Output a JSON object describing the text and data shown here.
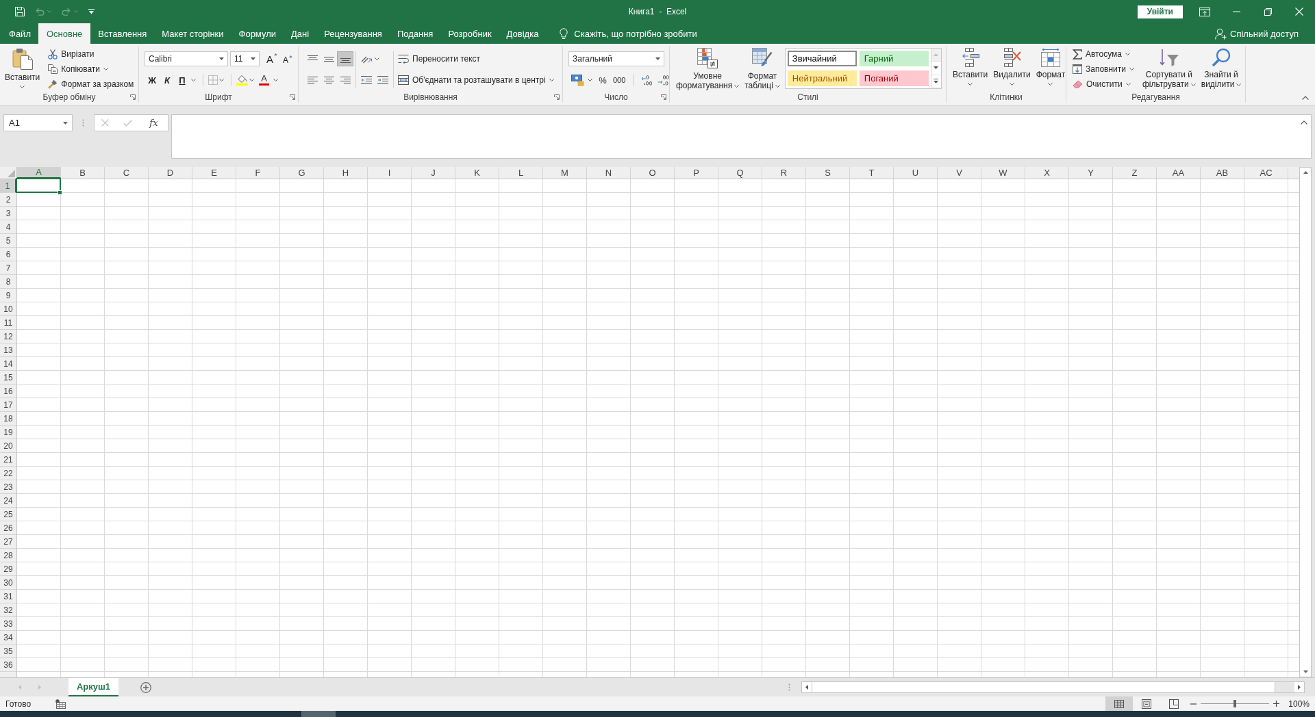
{
  "quick_access": [
    {
      "kind": "save",
      "disabled": false
    },
    {
      "kind": "undo",
      "disabled": true
    },
    {
      "kind": "redo",
      "disabled": true
    },
    {
      "kind": "customize",
      "disabled": false
    }
  ],
  "window": {
    "title": "Книга1  -  Excel",
    "sign_in": "Увійти"
  },
  "ribbon_tabs": [
    {
      "label": "Файл",
      "selected": false
    },
    {
      "label": "Основне",
      "selected": true
    },
    {
      "label": "Вставлення",
      "selected": false
    },
    {
      "label": "Макет сторінки",
      "selected": false
    },
    {
      "label": "Формули",
      "selected": false
    },
    {
      "label": "Дані",
      "selected": false
    },
    {
      "label": "Рецензування",
      "selected": false
    },
    {
      "label": "Подання",
      "selected": false
    },
    {
      "label": "Розробник",
      "selected": false
    },
    {
      "label": "Довідка",
      "selected": false
    }
  ],
  "tell_me": {
    "label": "Скажіть, що потрібно зробити"
  },
  "share": {
    "label": "Спільний доступ"
  },
  "ribbon": {
    "clipboard": {
      "title": "Буфер обміну",
      "paste": "Вставити",
      "commands": [
        {
          "kind": "cut",
          "label": "Вирізати",
          "dropdown": false
        },
        {
          "kind": "copy",
          "label": "Копіювати",
          "dropdown": true
        },
        {
          "kind": "painter",
          "label": "Формат за зразком",
          "dropdown": false
        }
      ]
    },
    "font": {
      "title": "Шрифт",
      "font_name": "Calibri",
      "font_size": "11",
      "grow": "A",
      "shrink": "A",
      "styles": [
        {
          "kind": "bold",
          "label": "Ж"
        },
        {
          "kind": "italic",
          "label": "К"
        },
        {
          "kind": "underline",
          "label": "П"
        }
      ],
      "font_color": "A"
    },
    "alignment": {
      "title": "Вирівнювання",
      "vertical": [
        {
          "kind": "top",
          "on": false
        },
        {
          "kind": "middle",
          "on": false
        },
        {
          "kind": "bottom",
          "on": true
        }
      ],
      "horizontal": [
        {
          "kind": "left"
        },
        {
          "kind": "center"
        },
        {
          "kind": "right"
        }
      ],
      "wrap_text": "Переносити текст",
      "merge": "Об'єднати та розташувати в центрі"
    },
    "number": {
      "title": "Число",
      "format": "Загальний",
      "percent": "%",
      "thousands": "000"
    },
    "styles": {
      "title": "Стилі",
      "conditional": [
        "Умовне",
        "форматування"
      ],
      "format_table": [
        "Формат",
        "таблиці"
      ],
      "gallery": [
        {
          "kind": "normal",
          "label": "Звичайний",
          "color": "#ffffff",
          "selected": true
        },
        {
          "kind": "good",
          "label": "Гарний",
          "color": "#c6efce",
          "selected": false
        },
        {
          "kind": "neutral",
          "label": "Нейтральний",
          "color": "#ffeb9c",
          "selected": false
        },
        {
          "kind": "bad",
          "label": "Поганий",
          "color": "#ffc7ce",
          "selected": false
        }
      ],
      "gallery_controls": [
        {
          "kind": "up",
          "disabled": true
        },
        {
          "kind": "down",
          "disabled": false
        },
        {
          "kind": "more",
          "disabled": false
        }
      ]
    },
    "cells": {
      "title": "Клітинки",
      "commands": [
        {
          "kind": "insert",
          "label": "Вставити"
        },
        {
          "kind": "delete",
          "label": "Видалити"
        },
        {
          "kind": "format",
          "label": "Формат"
        }
      ]
    },
    "editing": {
      "title": "Редагування",
      "commands": [
        {
          "kind": "autosum",
          "label": "Автосума"
        },
        {
          "kind": "fill",
          "label": "Заповнити"
        },
        {
          "kind": "clear",
          "label": "Очистити"
        }
      ],
      "sort": [
        "Сортувати й",
        "фільтрувати"
      ],
      "find": [
        "Знайти й",
        "виділити"
      ]
    }
  },
  "formula_bar": {
    "name_box": "A1",
    "buttons": [
      {
        "kind": "cancel",
        "disabled": true
      },
      {
        "kind": "enter",
        "disabled": true
      }
    ],
    "function_label": "fx"
  },
  "columns": [
    {
      "label": "A",
      "selected": true
    },
    {
      "label": "B",
      "selected": false
    },
    {
      "label": "C",
      "selected": false
    },
    {
      "label": "D",
      "selected": false
    },
    {
      "label": "E",
      "selected": false
    },
    {
      "label": "F",
      "selected": false
    },
    {
      "label": "G",
      "selected": false
    },
    {
      "label": "H",
      "selected": false
    },
    {
      "label": "I",
      "selected": false
    },
    {
      "label": "J",
      "selected": false
    },
    {
      "label": "K",
      "selected": false
    },
    {
      "label": "L",
      "selected": false
    },
    {
      "label": "M",
      "selected": false
    },
    {
      "label": "N",
      "selected": false
    },
    {
      "label": "O",
      "selected": false
    },
    {
      "label": "P",
      "selected": false
    },
    {
      "label": "Q",
      "selected": false
    },
    {
      "label": "R",
      "selected": false
    },
    {
      "label": "S",
      "selected": false
    },
    {
      "label": "T",
      "selected": false
    },
    {
      "label": "U",
      "selected": false
    },
    {
      "label": "V",
      "selected": false
    },
    {
      "label": "W",
      "selected": false
    },
    {
      "label": "X",
      "selected": false
    },
    {
      "label": "Y",
      "selected": false
    },
    {
      "label": "Z",
      "selected": false
    },
    {
      "label": "AA",
      "selected": false
    },
    {
      "label": "AB",
      "selected": false
    },
    {
      "label": "AC",
      "selected": false
    }
  ],
  "rows": [
    {
      "label": "1",
      "selected": true
    },
    {
      "label": "2",
      "selected": false
    },
    {
      "label": "3",
      "selected": false
    },
    {
      "label": "4",
      "selected": false
    },
    {
      "label": "5",
      "selected": false
    },
    {
      "label": "6",
      "selected": false
    },
    {
      "label": "7",
      "selected": false
    },
    {
      "label": "8",
      "selected": false
    },
    {
      "label": "9",
      "selected": false
    },
    {
      "label": "10",
      "selected": false
    },
    {
      "label": "11",
      "selected": false
    },
    {
      "label": "12",
      "selected": false
    },
    {
      "label": "13",
      "selected": false
    },
    {
      "label": "14",
      "selected": false
    },
    {
      "label": "15",
      "selected": false
    },
    {
      "label": "16",
      "selected": false
    },
    {
      "label": "17",
      "selected": false
    },
    {
      "label": "18",
      "selected": false
    },
    {
      "label": "19",
      "selected": false
    },
    {
      "label": "20",
      "selected": false
    },
    {
      "label": "21",
      "selected": false
    },
    {
      "label": "22",
      "selected": false
    },
    {
      "label": "23",
      "selected": false
    },
    {
      "label": "24",
      "selected": false
    },
    {
      "label": "25",
      "selected": false
    },
    {
      "label": "26",
      "selected": false
    },
    {
      "label": "27",
      "selected": false
    },
    {
      "label": "28",
      "selected": false
    },
    {
      "label": "29",
      "selected": false
    },
    {
      "label": "30",
      "selected": false
    },
    {
      "label": "31",
      "selected": false
    },
    {
      "label": "32",
      "selected": false
    },
    {
      "label": "33",
      "selected": false
    },
    {
      "label": "34",
      "selected": false
    },
    {
      "label": "35",
      "selected": false
    },
    {
      "label": "36",
      "selected": false
    }
  ],
  "sheet_nav": [
    {
      "kind": "previous",
      "disabled": true
    },
    {
      "kind": "next",
      "disabled": true
    }
  ],
  "sheets": [
    {
      "label": "Аркуш1",
      "selected": true
    }
  ],
  "status_bar": {
    "status": "Готово",
    "views": [
      {
        "kind": "normal",
        "selected": true
      },
      {
        "kind": "page_layout",
        "selected": false
      },
      {
        "kind": "page_break",
        "selected": false
      }
    ],
    "zoom_slider": {
      "level": 0.5
    },
    "zoom": "100%"
  }
}
